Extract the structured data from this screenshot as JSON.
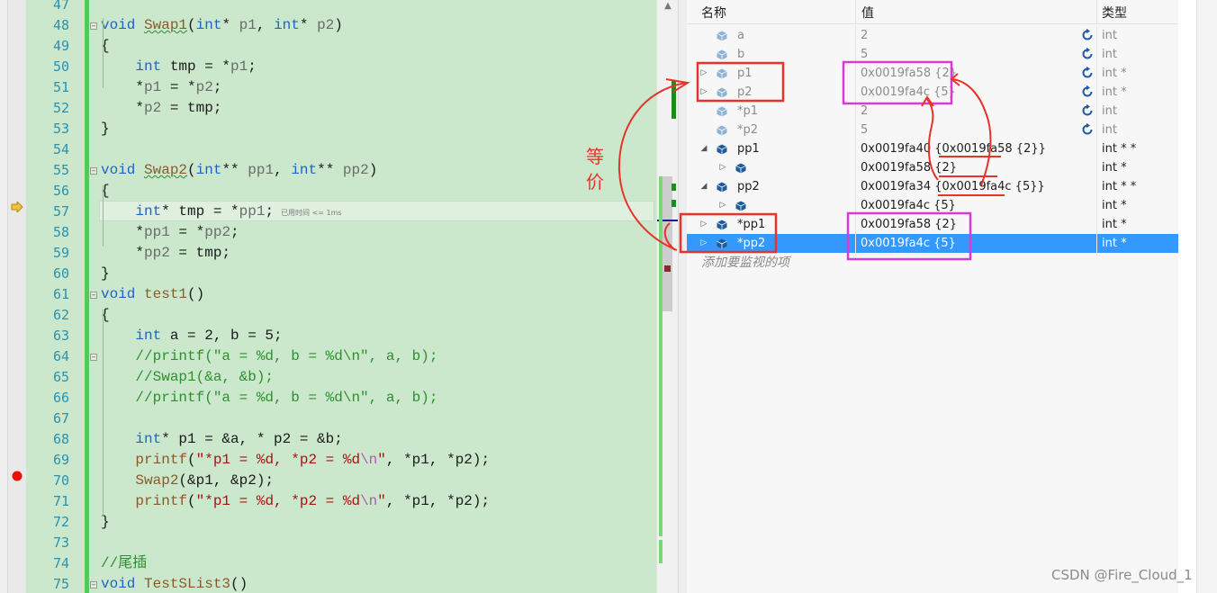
{
  "editor": {
    "lines": [
      {
        "n": 47,
        "code": []
      },
      {
        "n": 48,
        "fold": true,
        "code": [
          [
            "kw",
            "void "
          ],
          [
            "fn-u",
            "Swap1"
          ],
          [
            "plain",
            "("
          ],
          [
            "kw",
            "int"
          ],
          [
            "plain",
            "* "
          ],
          [
            "prm",
            "p1"
          ],
          [
            "plain",
            ", "
          ],
          [
            "kw",
            "int"
          ],
          [
            "plain",
            "* "
          ],
          [
            "prm",
            "p2"
          ],
          [
            "plain",
            ")"
          ]
        ]
      },
      {
        "n": 49,
        "code": [
          [
            "plain",
            "{"
          ]
        ]
      },
      {
        "n": 50,
        "code": [
          [
            "plain",
            "    "
          ],
          [
            "kw",
            "int "
          ],
          [
            "plain",
            "tmp = *"
          ],
          [
            "prm",
            "p1"
          ],
          [
            "plain",
            ";"
          ]
        ]
      },
      {
        "n": 51,
        "code": [
          [
            "plain",
            "    *"
          ],
          [
            "prm",
            "p1"
          ],
          [
            "plain",
            " = *"
          ],
          [
            "prm",
            "p2"
          ],
          [
            "plain",
            ";"
          ]
        ]
      },
      {
        "n": 52,
        "code": [
          [
            "plain",
            "    *"
          ],
          [
            "prm",
            "p2"
          ],
          [
            "plain",
            " = tmp;"
          ]
        ]
      },
      {
        "n": 53,
        "code": [
          [
            "plain",
            "}"
          ]
        ]
      },
      {
        "n": 54,
        "code": []
      },
      {
        "n": 55,
        "fold": true,
        "code": [
          [
            "kw",
            "void "
          ],
          [
            "fn-u",
            "Swap2"
          ],
          [
            "plain",
            "("
          ],
          [
            "kw",
            "int"
          ],
          [
            "plain",
            "** "
          ],
          [
            "prm",
            "pp1"
          ],
          [
            "plain",
            ", "
          ],
          [
            "kw",
            "int"
          ],
          [
            "plain",
            "** "
          ],
          [
            "prm",
            "pp2"
          ],
          [
            "plain",
            ")"
          ]
        ]
      },
      {
        "n": 56,
        "code": [
          [
            "plain",
            "{"
          ]
        ]
      },
      {
        "n": 57,
        "code": [
          [
            "plain",
            "    "
          ],
          [
            "kw",
            "int"
          ],
          [
            "plain",
            "* tmp = *"
          ],
          [
            "prm",
            "pp1"
          ],
          [
            "plain",
            ";"
          ]
        ],
        "hint": "已用时间 <= 1ms"
      },
      {
        "n": 58,
        "code": [
          [
            "plain",
            "    *"
          ],
          [
            "prm",
            "pp1"
          ],
          [
            "plain",
            " = *"
          ],
          [
            "prm",
            "pp2"
          ],
          [
            "plain",
            ";"
          ]
        ]
      },
      {
        "n": 59,
        "code": [
          [
            "plain",
            "    *"
          ],
          [
            "prm",
            "pp2"
          ],
          [
            "plain",
            " = tmp;"
          ]
        ]
      },
      {
        "n": 60,
        "code": [
          [
            "plain",
            "}"
          ]
        ]
      },
      {
        "n": 61,
        "fold": true,
        "code": [
          [
            "kw",
            "void "
          ],
          [
            "fn",
            "test1"
          ],
          [
            "plain",
            "()"
          ]
        ]
      },
      {
        "n": 62,
        "code": [
          [
            "plain",
            "{"
          ]
        ]
      },
      {
        "n": 63,
        "code": [
          [
            "plain",
            "    "
          ],
          [
            "kw",
            "int "
          ],
          [
            "plain",
            "a = 2, b = 5;"
          ]
        ]
      },
      {
        "n": 64,
        "fold": true,
        "code": [
          [
            "cm",
            "    //printf(\"a = %d, b = %d\\n\", a, b);"
          ]
        ]
      },
      {
        "n": 65,
        "code": [
          [
            "cm",
            "    //Swap1(&a, &b);"
          ]
        ]
      },
      {
        "n": 66,
        "code": [
          [
            "cm",
            "    //printf(\"a = %d, b = %d\\n\", a, b);"
          ]
        ]
      },
      {
        "n": 67,
        "code": []
      },
      {
        "n": 68,
        "code": [
          [
            "plain",
            "    "
          ],
          [
            "kw",
            "int"
          ],
          [
            "plain",
            "* p1 = &a, * p2 = &b;"
          ]
        ]
      },
      {
        "n": 69,
        "code": [
          [
            "plain",
            "    "
          ],
          [
            "fn",
            "printf"
          ],
          [
            "plain",
            "("
          ],
          [
            "str",
            "\"*p1 = %d, *p2 = %d"
          ],
          [
            "esc",
            "\\n"
          ],
          [
            "str",
            "\""
          ],
          [
            "plain",
            ", *p1, *p2);"
          ]
        ]
      },
      {
        "n": 70,
        "code": [
          [
            "plain",
            "    "
          ],
          [
            "fn",
            "Swap2"
          ],
          [
            "plain",
            "(&p1, &p2);"
          ]
        ]
      },
      {
        "n": 71,
        "code": [
          [
            "plain",
            "    "
          ],
          [
            "fn",
            "printf"
          ],
          [
            "plain",
            "("
          ],
          [
            "str",
            "\"*p1 = %d, *p2 = %d"
          ],
          [
            "esc",
            "\\n"
          ],
          [
            "str",
            "\""
          ],
          [
            "plain",
            ", *p1, *p2);"
          ]
        ]
      },
      {
        "n": 72,
        "code": [
          [
            "plain",
            "}"
          ]
        ]
      },
      {
        "n": 73,
        "code": []
      },
      {
        "n": 74,
        "code": [
          [
            "cm",
            "//尾插"
          ]
        ]
      },
      {
        "n": 75,
        "fold": true,
        "code": [
          [
            "kw",
            "void "
          ],
          [
            "fn",
            "TestSList3"
          ],
          [
            "plain",
            "()"
          ]
        ]
      }
    ]
  },
  "watch": {
    "headers": {
      "name": "名称",
      "value": "值",
      "type": "类型"
    },
    "rows": [
      {
        "name": "a",
        "value": "2",
        "type": "int",
        "indent": 0,
        "arrow": "",
        "refresh": true,
        "dim": true
      },
      {
        "name": "b",
        "value": "5",
        "type": "int",
        "indent": 0,
        "arrow": "",
        "refresh": true,
        "dim": true
      },
      {
        "name": "p1",
        "value": "0x0019fa58 {2}",
        "type": "int *",
        "indent": 0,
        "arrow": "▷",
        "refresh": true,
        "dim": true
      },
      {
        "name": "p2",
        "value": "0x0019fa4c {5}",
        "type": "int *",
        "indent": 0,
        "arrow": "▷",
        "refresh": true,
        "dim": true
      },
      {
        "name": "*p1",
        "value": "2",
        "type": "int",
        "indent": 0,
        "arrow": "",
        "refresh": true,
        "dim": true
      },
      {
        "name": "*p2",
        "value": "5",
        "type": "int",
        "indent": 0,
        "arrow": "",
        "refresh": true,
        "dim": true
      },
      {
        "name": "pp1",
        "value": "0x0019fa40 {0x0019fa58 {2}}",
        "type": "int * *",
        "indent": 0,
        "arrow": "◢",
        "refresh": false,
        "dim": false
      },
      {
        "name": "",
        "value": "0x0019fa58 {2}",
        "type": "int *",
        "indent": 1,
        "arrow": "▷",
        "refresh": false,
        "dim": false
      },
      {
        "name": "pp2",
        "value": "0x0019fa34 {0x0019fa4c {5}}",
        "type": "int * *",
        "indent": 0,
        "arrow": "◢",
        "refresh": false,
        "dim": false
      },
      {
        "name": "",
        "value": "0x0019fa4c {5}",
        "type": "int *",
        "indent": 1,
        "arrow": "▷",
        "refresh": false,
        "dim": false
      },
      {
        "name": "*pp1",
        "value": "0x0019fa58 {2}",
        "type": "int *",
        "indent": 0,
        "arrow": "▷",
        "refresh": false,
        "dim": false
      },
      {
        "name": "*pp2",
        "value": "0x0019fa4c {5}",
        "type": "int *",
        "indent": 0,
        "arrow": "▷",
        "refresh": false,
        "dim": false,
        "selected": true
      }
    ],
    "add_item": "添加要监视的项"
  },
  "annotation": {
    "label_1": "等",
    "label_2": "价",
    "color": "#e8332b",
    "box_color": "#d63bd6"
  },
  "watermark": "CSDN @Fire_Cloud_1"
}
